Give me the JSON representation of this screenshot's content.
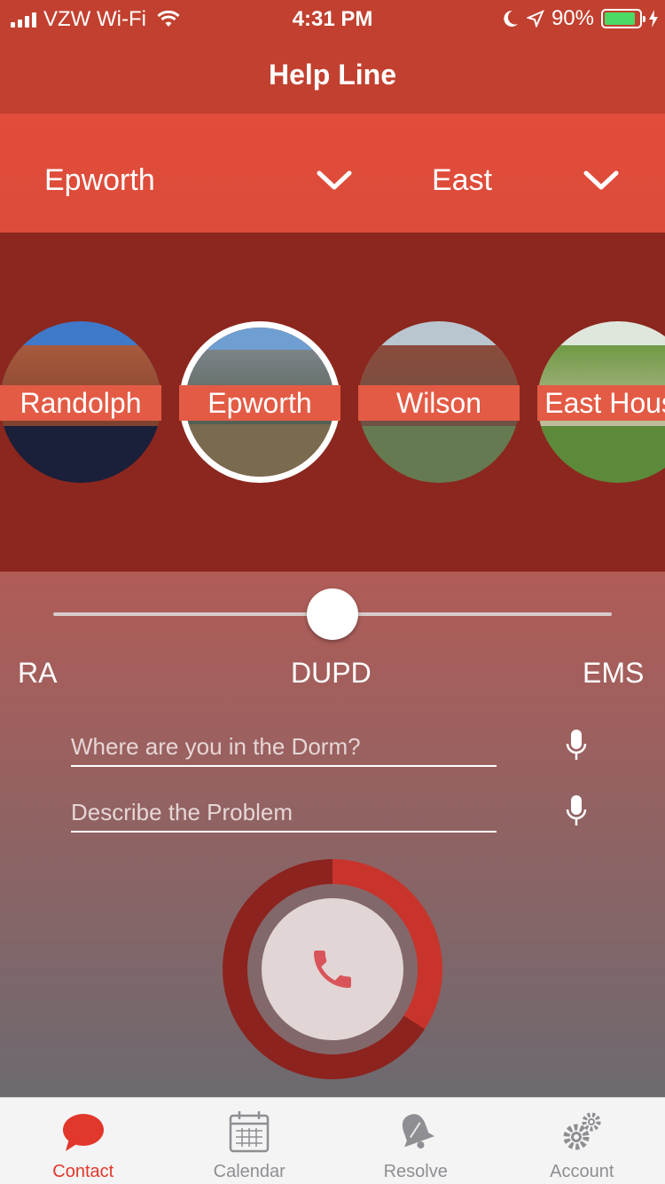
{
  "status_bar": {
    "carrier": "VZW Wi-Fi",
    "time": "4:31 PM",
    "battery": "90%"
  },
  "nav": {
    "title": "Help Line"
  },
  "pickers": {
    "dorm": "Epworth",
    "area": "East"
  },
  "dorms": [
    {
      "label": "Randolph",
      "selected": false
    },
    {
      "label": "Epworth",
      "selected": true
    },
    {
      "label": "Wilson",
      "selected": false
    },
    {
      "label": "East House",
      "selected": false
    }
  ],
  "contact_level": {
    "options": [
      "RA",
      "DUPD",
      "EMS"
    ],
    "selected": "DUPD",
    "value": 0.5
  },
  "form": {
    "location_placeholder": "Where are you in the Dorm?",
    "problem_placeholder": "Describe the Problem"
  },
  "call": {
    "progress": 0.34,
    "icon": "phone-icon"
  },
  "tabs": [
    {
      "label": "Contact",
      "icon": "chat-bubble-icon",
      "active": true
    },
    {
      "label": "Calendar",
      "icon": "calendar-icon",
      "active": false
    },
    {
      "label": "Resolve",
      "icon": "bell-icon",
      "active": false
    },
    {
      "label": "Account",
      "icon": "gears-icon",
      "active": false
    }
  ],
  "colors": {
    "accent": "#e2372b",
    "header": "#c2402f",
    "picker_bar": "#e04b3a",
    "carousel_bg": "#8b271e"
  }
}
